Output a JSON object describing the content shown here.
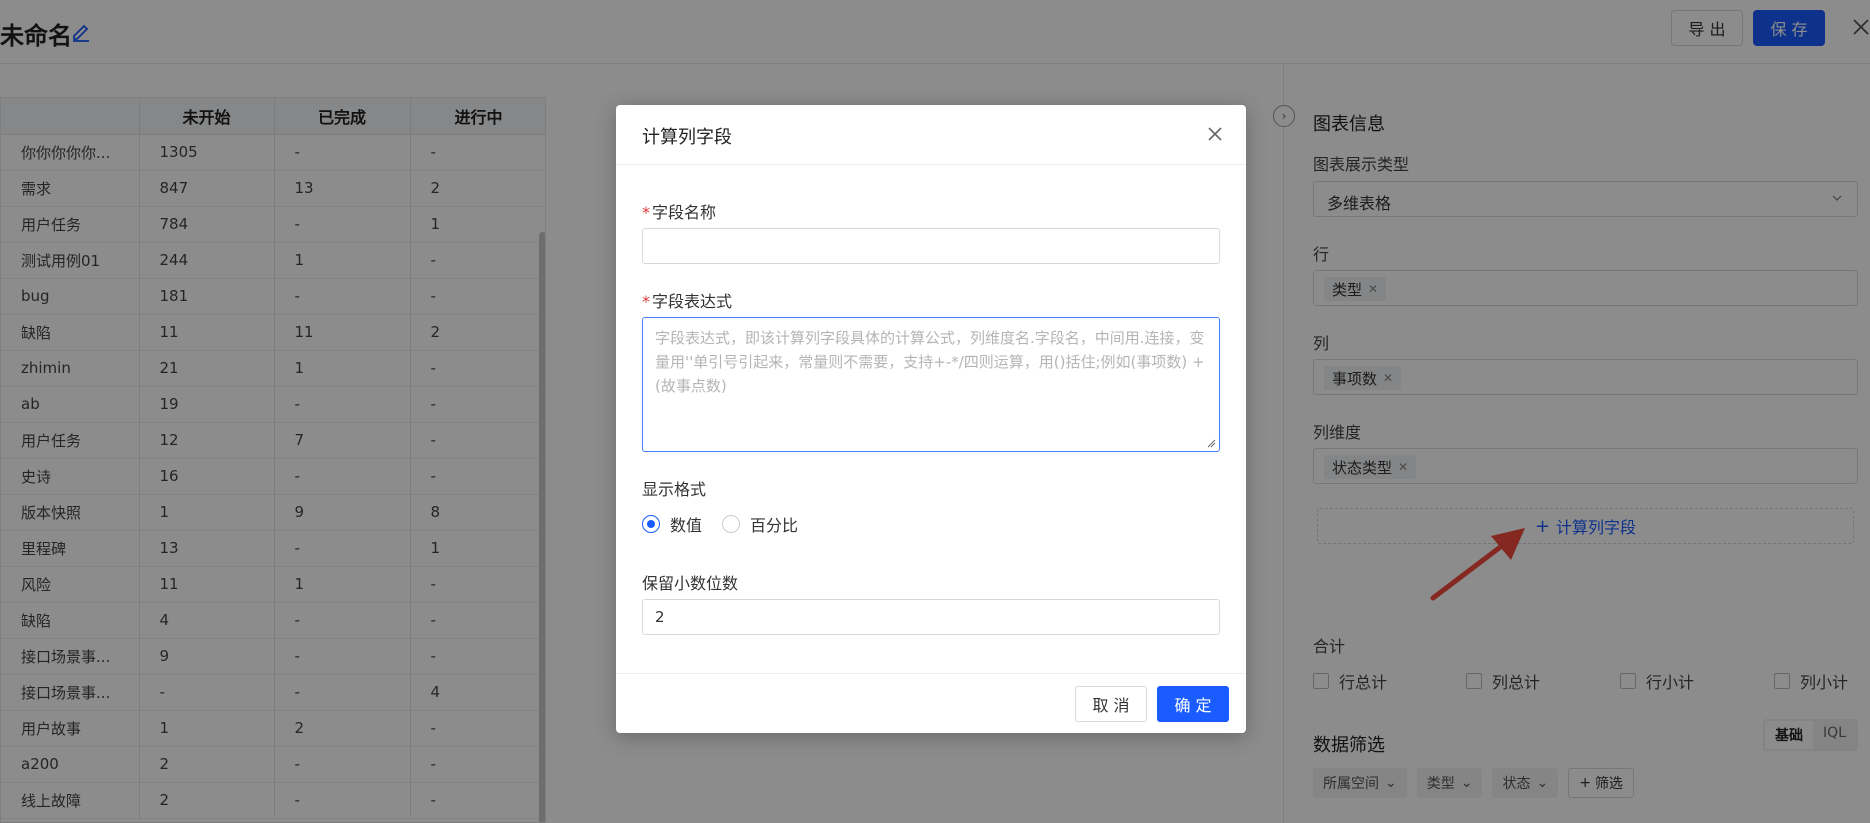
{
  "header": {
    "title": "未命名",
    "export_label": "导 出",
    "save_label": "保 存"
  },
  "table": {
    "columns": [
      "",
      "未开始",
      "已完成",
      "进行中"
    ],
    "rows": [
      [
        "你你你你你...",
        "1305",
        "-",
        "-"
      ],
      [
        "需求",
        "847",
        "13",
        "2"
      ],
      [
        "用户任务",
        "784",
        "-",
        "1"
      ],
      [
        "测试用例01",
        "244",
        "1",
        "-"
      ],
      [
        "bug",
        "181",
        "-",
        "-"
      ],
      [
        "缺陷",
        "11",
        "11",
        "2"
      ],
      [
        "zhimin",
        "21",
        "1",
        "-"
      ],
      [
        "ab",
        "19",
        "-",
        "-"
      ],
      [
        "用户任务",
        "12",
        "7",
        "-"
      ],
      [
        "史诗",
        "16",
        "-",
        "-"
      ],
      [
        "版本快照",
        "1",
        "9",
        "8"
      ],
      [
        "里程碑",
        "13",
        "-",
        "1"
      ],
      [
        "风险",
        "11",
        "1",
        "-"
      ],
      [
        "缺陷",
        "4",
        "-",
        "-"
      ],
      [
        "接口场景事...",
        "9",
        "-",
        "-"
      ],
      [
        "接口场景事...",
        "-",
        "-",
        "4"
      ],
      [
        "用户故事",
        "1",
        "2",
        "-"
      ],
      [
        "a200",
        "2",
        "-",
        "-"
      ],
      [
        "线上故障",
        "2",
        "-",
        "-"
      ]
    ]
  },
  "right_panel": {
    "heading": "图表信息",
    "chart_type_label": "图表展示类型",
    "chart_type_value": "多维表格",
    "row_label": "行",
    "row_tag": "类型",
    "col_label": "列",
    "col_tag": "事项数",
    "col_dim_label": "列维度",
    "col_dim_tag": "状态类型",
    "add_calc_label": "计算列字段",
    "total_label": "合计",
    "totals": [
      "行总计",
      "列总计",
      "行小计",
      "列小计"
    ],
    "filter_label": "数据筛选",
    "filter_modes": [
      "基础",
      "IQL"
    ],
    "filter_chips": [
      "所属空间",
      "类型",
      "状态"
    ],
    "filter_add": "筛选"
  },
  "modal": {
    "title": "计算列字段",
    "name_label": "字段名称",
    "name_value": "",
    "expr_label": "字段表达式",
    "expr_placeholder": "字段表达式，即该计算列字段具体的计算公式，列维度名.字段名，中间用.连接，变量用''单引号引起来，常量则不需要，支持+-*/四则运算，用()括住;例如(事项数) + (故事点数)",
    "format_label": "显示格式",
    "format_options": [
      "数值",
      "百分比"
    ],
    "format_selected": "数值",
    "decimals_label": "保留小数位数",
    "decimals_value": "2",
    "cancel_label": "取 消",
    "ok_label": "确 定"
  },
  "colors": {
    "primary": "#1a5cff",
    "required": "#e03b3b",
    "annotation_arrow": "#f04a3c"
  }
}
